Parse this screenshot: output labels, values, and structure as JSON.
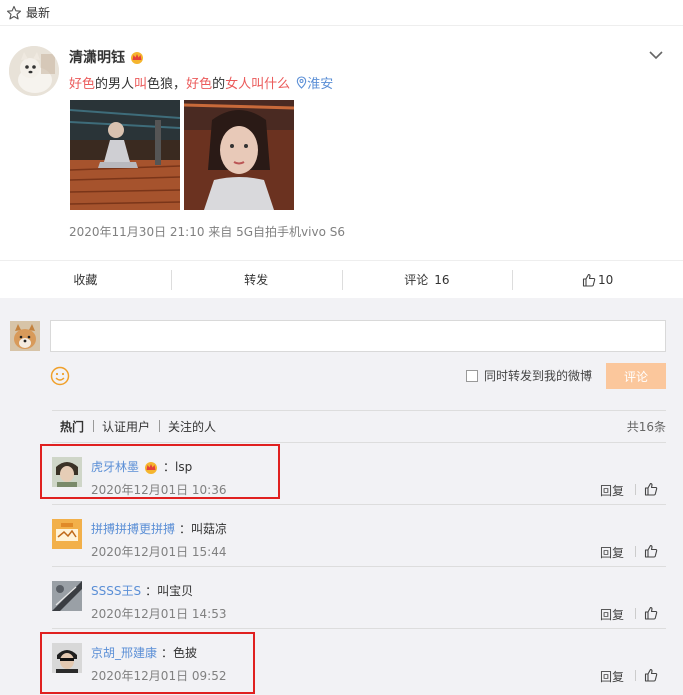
{
  "top": {
    "label": "最新"
  },
  "post": {
    "username": "清潇明钰",
    "text_parts": [
      {
        "t": "好色",
        "cls": "hl"
      },
      {
        "t": "的男人",
        "cls": ""
      },
      {
        "t": "叫",
        "cls": "hl"
      },
      {
        "t": "色狼，",
        "cls": ""
      },
      {
        "t": "好色",
        "cls": "hl"
      },
      {
        "t": "的",
        "cls": ""
      },
      {
        "t": "女人叫什么",
        "cls": "hl"
      }
    ],
    "location": "淮安",
    "meta": "2020年11月30日 21:10  来自 5G自拍手机vivo S6"
  },
  "actions": {
    "favorite": "收藏",
    "repost": "转发",
    "comment_label": "评论",
    "comment_count": "16",
    "like_count": "10"
  },
  "composer": {
    "forward_label": "同时转发到我的微博",
    "send_label": "评论"
  },
  "tabs": {
    "items": [
      "热门",
      "认证用户",
      "关注的人"
    ],
    "total": "共16条"
  },
  "comments": [
    {
      "name": "虎牙林墨",
      "crown": true,
      "text": "lsp",
      "time": "2020年12月01日 10:36",
      "reply": "回复"
    },
    {
      "name": "拼搏拼搏更拼搏",
      "crown": false,
      "text": "叫菇凉",
      "time": "2020年12月01日 15:44",
      "reply": "回复"
    },
    {
      "name": "SSSS王S",
      "crown": false,
      "text": "叫宝贝",
      "time": "2020年12月01日 14:53",
      "reply": "回复"
    },
    {
      "name": "京胡_邢建康",
      "crown": false,
      "text": "色披",
      "time": "2020年12月01日 09:52",
      "reply": "回复"
    }
  ],
  "colors": {
    "highlight": "#eb5a5a",
    "link": "#5b8fd6",
    "send_button": "#fbc79c",
    "annotation_box": "#e02020"
  }
}
